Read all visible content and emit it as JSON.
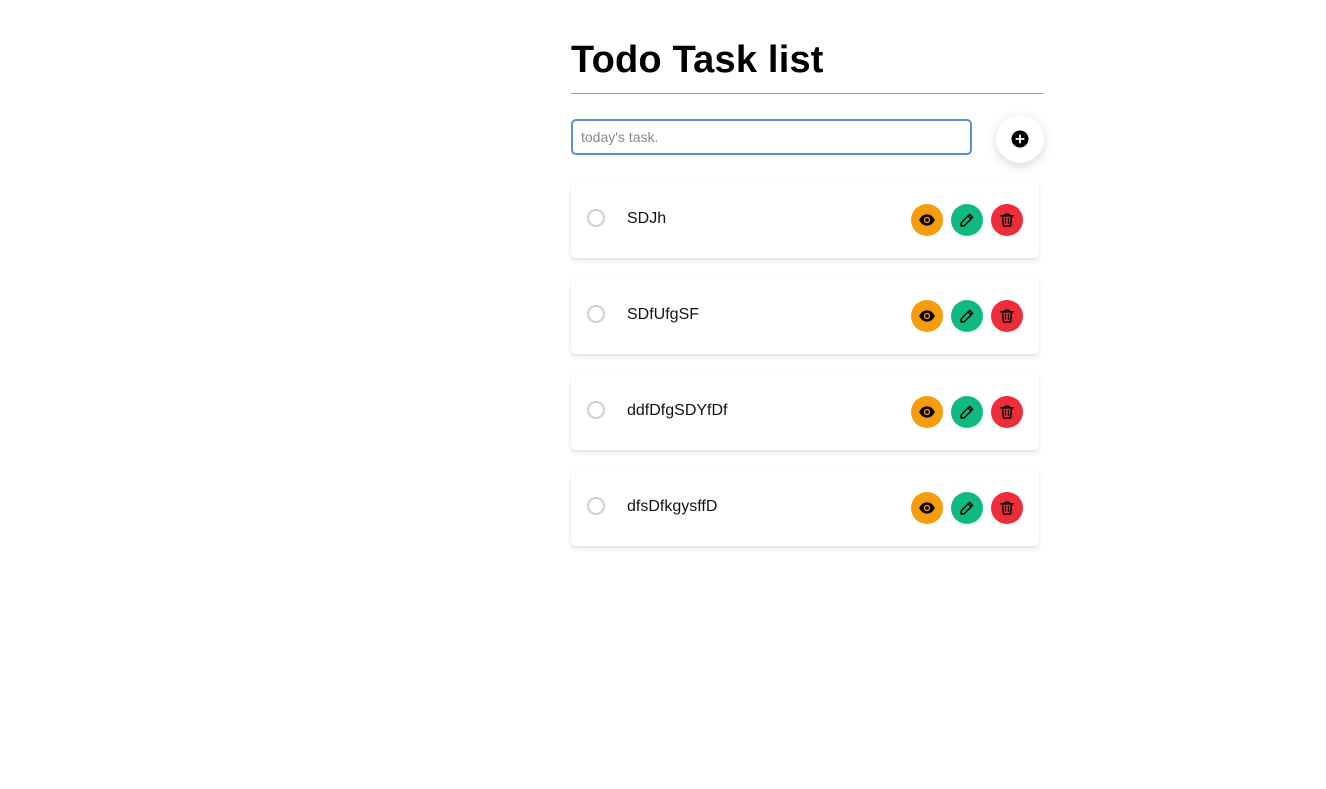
{
  "page": {
    "title": "Todo Task list"
  },
  "input": {
    "placeholder": "today's task.",
    "value": ""
  },
  "add_button": {
    "icon": "plus-circle-icon"
  },
  "tasks": [
    {
      "text": "SDJh",
      "completed": false
    },
    {
      "text": "SDfUfgSF",
      "completed": false
    },
    {
      "text": "ddfDfgSDYfDf",
      "completed": false
    },
    {
      "text": "dfsDfkgysffD",
      "completed": false
    }
  ],
  "actions": {
    "view": {
      "icon": "eye-icon",
      "color": "#f59e0b"
    },
    "edit": {
      "icon": "pencil-icon",
      "color": "#10b981"
    },
    "delete": {
      "icon": "trash-icon",
      "color": "#ef2d3a"
    }
  },
  "colors": {
    "input_focus_border": "#5b8fd1",
    "divider": "#9a9a9a"
  }
}
